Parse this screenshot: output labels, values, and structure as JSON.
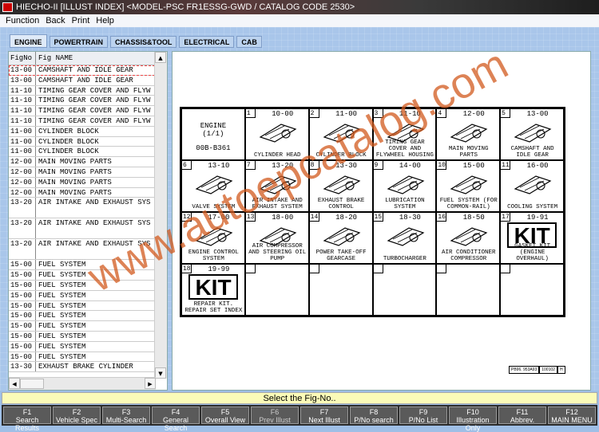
{
  "window": {
    "title": "HIECHO-II [ILLUST INDEX] <MODEL-PSC FR1ESSG-GWD  / CATALOG CODE  2530>"
  },
  "menu": [
    "Function",
    "Back",
    "Print",
    "Help"
  ],
  "tabs": [
    "ENGINE",
    "POWERTRAIN",
    "CHASSIS&TOOL",
    "ELECTRICAL",
    "CAB"
  ],
  "list": {
    "headers": [
      "FigNo",
      "Fig NAME"
    ],
    "rows": [
      [
        "13-00",
        "CAMSHAFT AND IDLE GEAR"
      ],
      [
        "13-00",
        "CAMSHAFT AND IDLE GEAR"
      ],
      [
        "11-10",
        "TIMING GEAR COVER AND FLYW"
      ],
      [
        "11-10",
        "TIMING GEAR COVER AND FLYW"
      ],
      [
        "11-10",
        "TIMING GEAR COVER AND FLYW"
      ],
      [
        "11-10",
        "TIMING GEAR COVER AND FLYW"
      ],
      [
        "11-00",
        "CYLINDER BLOCK"
      ],
      [
        "11-00",
        "CYLINDER BLOCK"
      ],
      [
        "11-00",
        "CYLINDER BLOCK"
      ],
      [
        "12-00",
        "MAIN MOVING PARTS"
      ],
      [
        "12-00",
        "MAIN MOVING PARTS"
      ],
      [
        "12-00",
        "MAIN MOVING PARTS"
      ],
      [
        "12-00",
        "MAIN MOVING PARTS"
      ],
      [
        "13-20",
        "AIR INTAKE AND EXHAUST SYS"
      ],
      [
        "13-20",
        "AIR INTAKE AND EXHAUST SYS"
      ],
      [
        "13-20",
        "AIR INTAKE AND EXHAUST SYS"
      ],
      [
        "15-00",
        "FUEL SYSTEM"
      ],
      [
        "15-00",
        "FUEL SYSTEM"
      ],
      [
        "15-00",
        "FUEL SYSTEM"
      ],
      [
        "15-00",
        "FUEL SYSTEM"
      ],
      [
        "15-00",
        "FUEL SYSTEM"
      ],
      [
        "15-00",
        "FUEL SYSTEM"
      ],
      [
        "15-00",
        "FUEL SYSTEM"
      ],
      [
        "15-00",
        "FUEL SYSTEM"
      ],
      [
        "15-00",
        "FUEL SYSTEM"
      ],
      [
        "15-00",
        "FUEL SYSTEM"
      ],
      [
        "13-30",
        "EXHAUST BRAKE CYLINDER"
      ]
    ]
  },
  "index": {
    "head": [
      "ENGINE",
      "(1/1)",
      "00B-B361"
    ],
    "cells": [
      {
        "n": "1",
        "fig": "10-00",
        "cap": "CYLINDER HEAD"
      },
      {
        "n": "2",
        "fig": "11-00",
        "cap": "CYLINDER BLOCK"
      },
      {
        "n": "3",
        "fig": "11-10",
        "cap": "TIMING GEAR COVER AND FLYWHEEL HOUSING"
      },
      {
        "n": "4",
        "fig": "12-00",
        "cap": "MAIN MOVING PARTS"
      },
      {
        "n": "5",
        "fig": "13-00",
        "cap": "CAMSHAFT AND IDLE GEAR"
      },
      {
        "n": "6",
        "fig": "13-10",
        "cap": "VALVE SYSTEM"
      },
      {
        "n": "7",
        "fig": "13-20",
        "cap": "AIR INTAKE AND EXHAUST SYSTEM"
      },
      {
        "n": "8",
        "fig": "13-30",
        "cap": "EXHAUST BRAKE CONTROL"
      },
      {
        "n": "9",
        "fig": "14-00",
        "cap": "LUBRICATION SYSTEM"
      },
      {
        "n": "10",
        "fig": "15-00",
        "cap": "FUEL SYSTEM (FOR COMMON-RAIL)"
      },
      {
        "n": "11",
        "fig": "16-00",
        "cap": "COOLING SYSTEM"
      },
      {
        "n": "12",
        "fig": "17-00",
        "cap": "ENGINE CONTROL SYSTEM"
      },
      {
        "n": "13",
        "fig": "18-00",
        "cap": "AIR COMPRESSOR AND STEERING OIL PUMP"
      },
      {
        "n": "14",
        "fig": "18-20",
        "cap": "POWER TAKE-OFF GEARCASE"
      },
      {
        "n": "15",
        "fig": "18-30",
        "cap": "TURBOCHARGER"
      },
      {
        "n": "16",
        "fig": "18-50",
        "cap": "AIR CONDITIONER COMPRESSOR"
      },
      {
        "n": "17",
        "fig": "19-91",
        "cap": "GASKET KIT (ENGINE OVERHAUL)",
        "kit": "KIT"
      },
      {
        "n": "18",
        "fig": "19-99",
        "cap": "REPAIR KIT. REPAIR SET INDEX",
        "kit": "KIT"
      }
    ],
    "ref": [
      "PB96. 953A93",
      "100102",
      "H"
    ]
  },
  "watermark": "www.autoepcatalog.com",
  "status": "Select the Fig-No..",
  "fkeys": [
    [
      "F1",
      "Search Results"
    ],
    [
      "F2",
      "Vehicle Spec"
    ],
    [
      "F3",
      "Multi-Search"
    ],
    [
      "F4",
      "General Search"
    ],
    [
      "F5",
      "Overall View"
    ],
    [
      "F6",
      "Prev Illust"
    ],
    [
      "F7",
      "Next Illust"
    ],
    [
      "F8",
      "P/No search"
    ],
    [
      "F9",
      "P/No List"
    ],
    [
      "F10",
      "Illustration Only"
    ],
    [
      "F11",
      "Abbrev."
    ],
    [
      "F12",
      "MAIN MENU"
    ]
  ]
}
